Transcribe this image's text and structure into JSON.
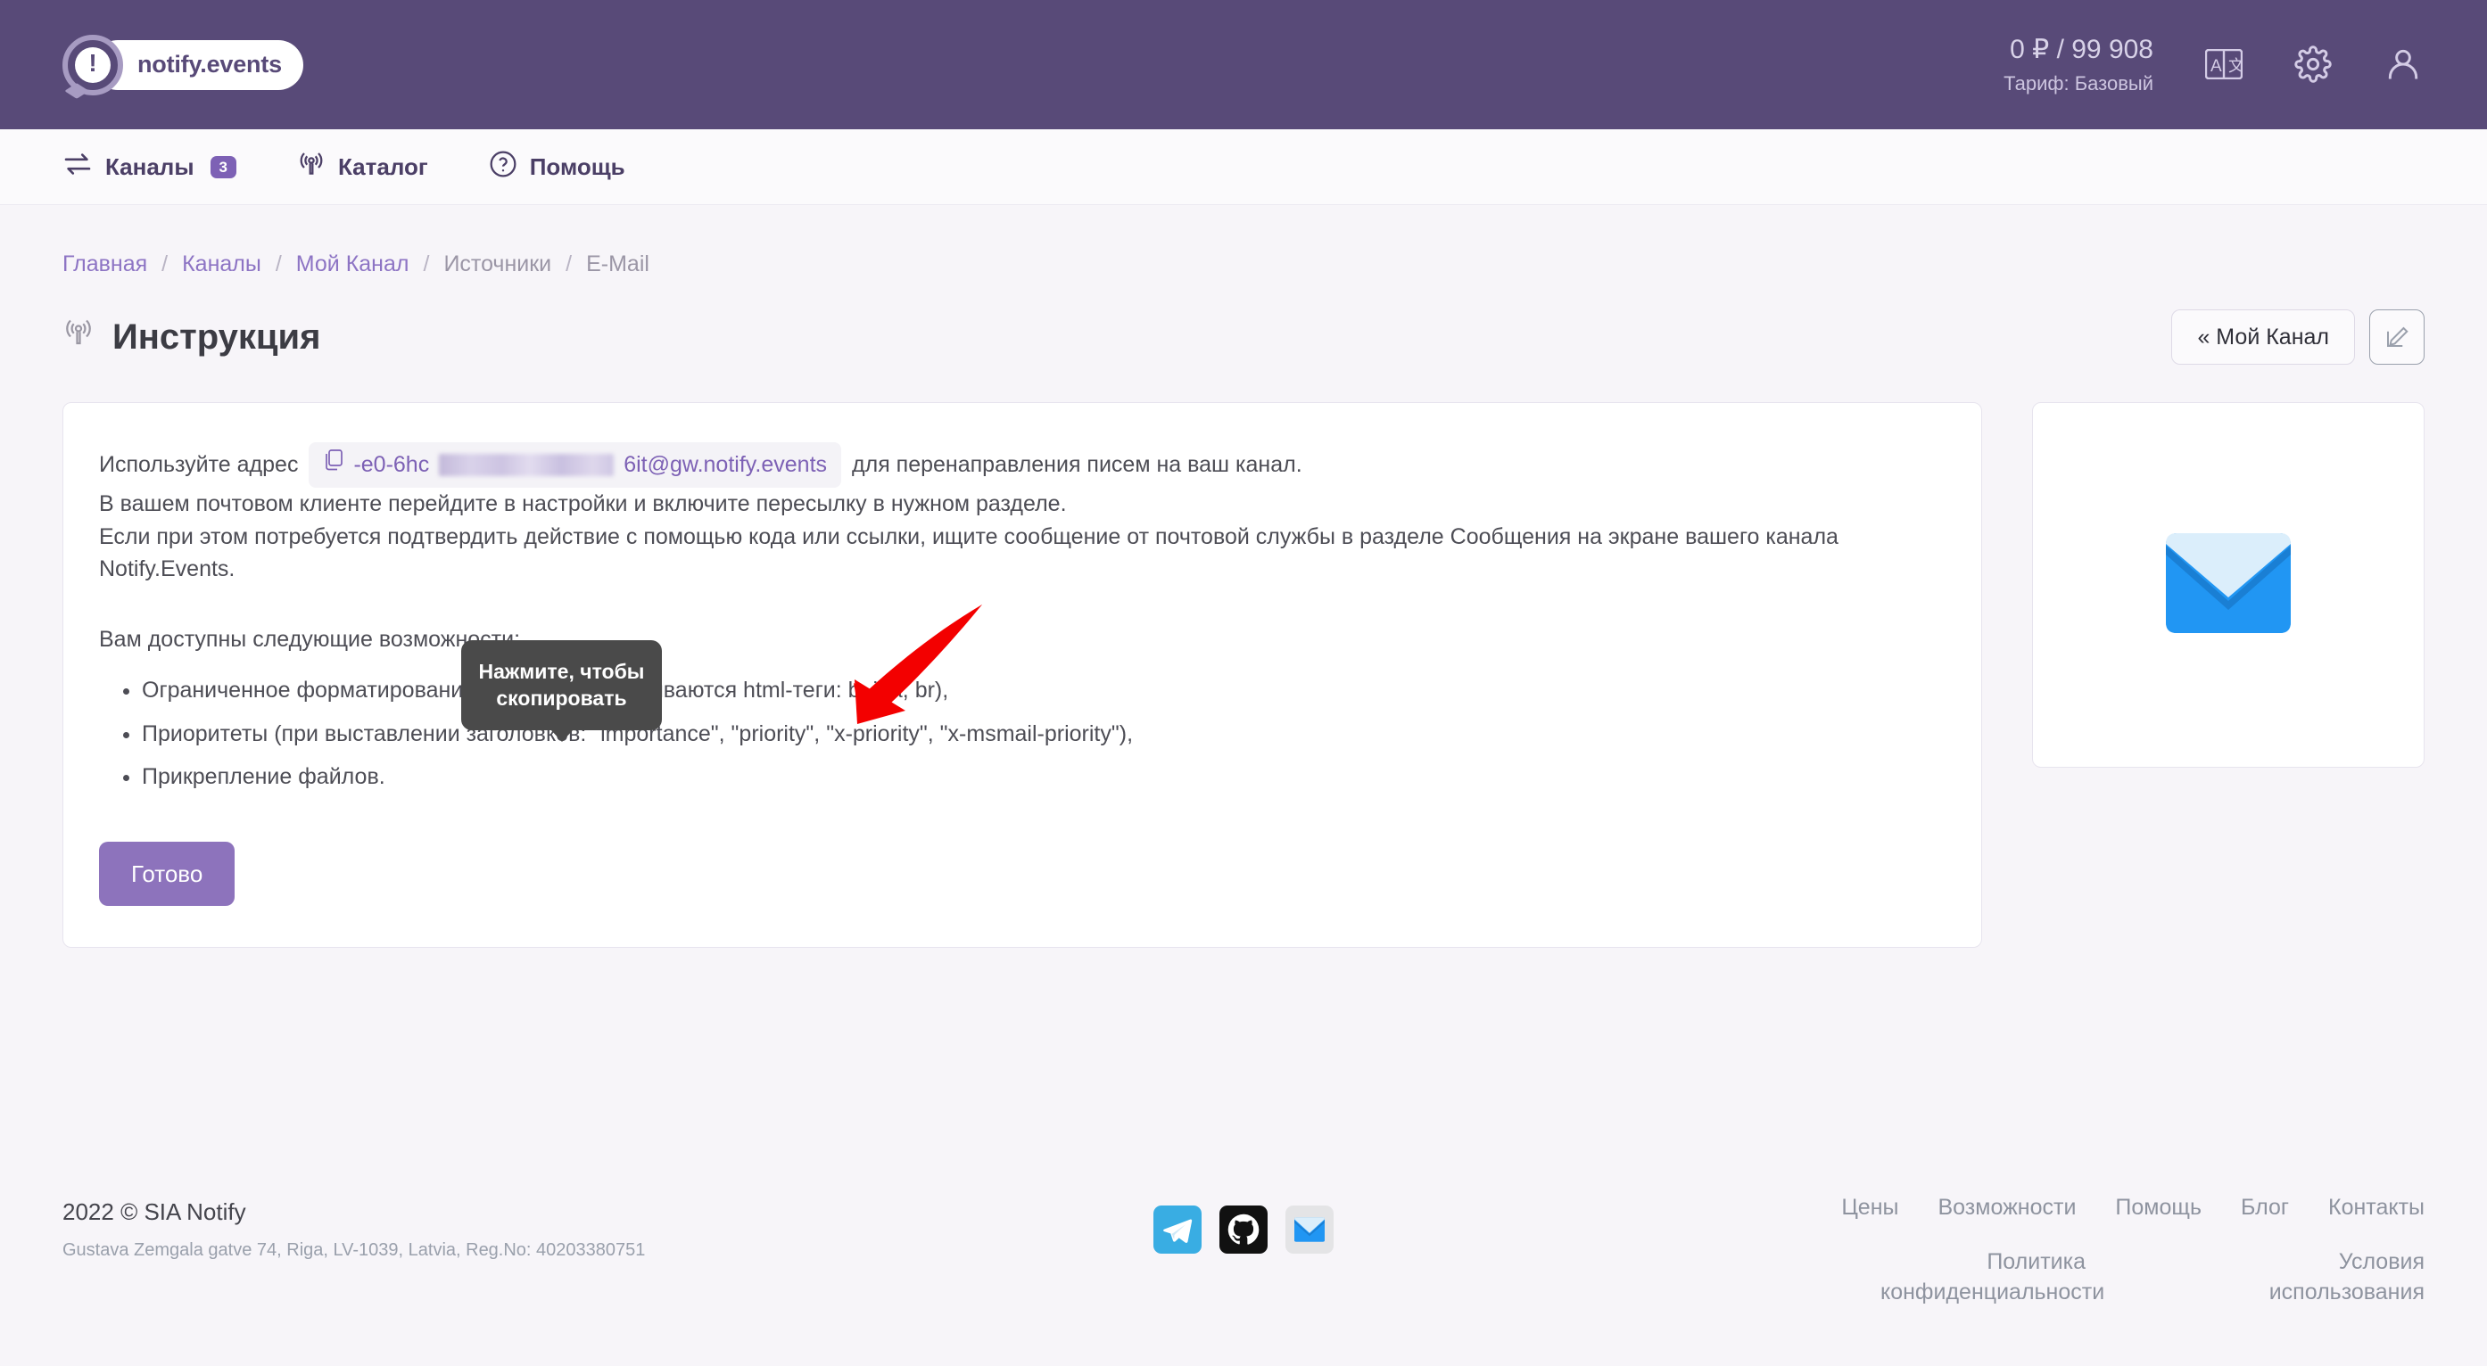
{
  "header": {
    "logo_text": "notify.events",
    "logo_mark": "exclamation-bubble",
    "balance": "0 ₽ / 99 908",
    "plan": "Тариф: Базовый",
    "icons": [
      "translate-icon",
      "gear-icon",
      "user-icon"
    ]
  },
  "nav": {
    "items": [
      {
        "label": "Каналы",
        "icon": "transfer-icon",
        "badge": "3"
      },
      {
        "label": "Каталог",
        "icon": "broadcast-icon",
        "badge": ""
      },
      {
        "label": "Помощь",
        "icon": "question-icon",
        "badge": ""
      }
    ]
  },
  "breadcrumb": {
    "items": [
      "Главная",
      "Каналы",
      "Мой Канал",
      "Источники",
      "E-Mail"
    ],
    "separator": "/"
  },
  "page": {
    "title": "Инструкция",
    "title_icon": "broadcast-icon",
    "back_button": "« Мой Канал",
    "edit_button_icon": "edit-pencil-icon"
  },
  "tooltip": {
    "line1": "Нажмите, чтобы",
    "line2": "скопировать"
  },
  "instruction": {
    "line1_prefix": "Используйте адрес",
    "email_visible_start": "-e0-6hc",
    "email_visible_end": "6it@gw.notify.events",
    "copy_icon": "copy-icon",
    "line1_suffix": "для перенаправления писем на ваш канал.",
    "line2": "В вашем почтовом клиенте перейдите в настройки и включите пересылку в нужном разделе.",
    "line3": "Если при этом потребуется подтвердить действие с помощью кода или ссылки, ищите сообщение от почтовой службы в разделе Сообщения на экране вашего канала Notify.Events.",
    "features_intro": "Вам доступны следующие возможности:",
    "features": [
      "Ограниченное форматирование текста (поддерживаются html-теги: b, i, a, br),",
      "Приоритеты (при выставлении заголовков: \"importance\", \"priority\", \"x-priority\", \"x-msmail-priority\"),",
      "Прикрепление файлов."
    ],
    "done_button": "Готово"
  },
  "side_card": {
    "illustration": "email-envelope-icon"
  },
  "footer": {
    "copyright": "2022 © SIA Notify",
    "address": "Gustava Zemgala gatve 74, Riga, LV-1039, Latvia, Reg.No: 40203380751",
    "social": [
      "telegram-icon",
      "github-icon",
      "email-icon"
    ],
    "links": [
      "Цены",
      "Возможности",
      "Помощь",
      "Блог",
      "Контакты"
    ],
    "legal": [
      "Политика конфиденциальности",
      "Условия использования"
    ]
  },
  "colors": {
    "header_bg": "#584a78",
    "accent": "#8d73bc",
    "link": "#8d74c4",
    "page_bg": "#f7f5f9",
    "arrow": "#f30000",
    "tooltip_bg": "#4a4a4a"
  }
}
